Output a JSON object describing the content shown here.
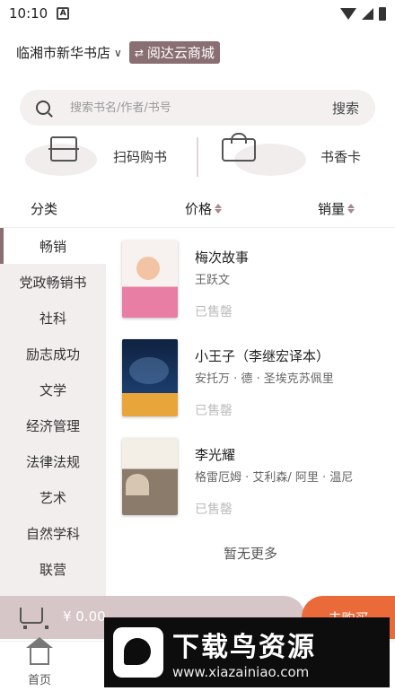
{
  "status_bar": {
    "time": "10:10",
    "notification_icon": "A"
  },
  "header": {
    "store_name": "临湘市新华书店",
    "store_chevron": "∨",
    "platform_name": "阅达云商城",
    "swap_symbol": "⇄"
  },
  "search": {
    "placeholder": "搜索书名/作者/书号",
    "button_label": "搜索"
  },
  "quick_actions": {
    "scan": {
      "label": "扫码购书",
      "icon": "scan-icon"
    },
    "card": {
      "label": "书香卡",
      "icon": "gift-card-icon"
    }
  },
  "filters": {
    "category": "分类",
    "price": "价格",
    "sales": "销量"
  },
  "sidebar": {
    "items": [
      {
        "label": "畅销"
      },
      {
        "label": "党政畅销书"
      },
      {
        "label": "社科"
      },
      {
        "label": "励志成功"
      },
      {
        "label": "文学"
      },
      {
        "label": "经济管理"
      },
      {
        "label": "法律法规"
      },
      {
        "label": "艺术"
      },
      {
        "label": "自然学科"
      },
      {
        "label": "联营"
      }
    ],
    "active_index": 0
  },
  "books": [
    {
      "title": "梅次故事",
      "author": "王跃文",
      "status": "已售罄"
    },
    {
      "title": "小王子（李继宏译本）",
      "author": "安托万 · 德 · 圣埃克苏佩里",
      "status": "已售罄"
    },
    {
      "title": "李光耀",
      "author": "格雷厄姆 · 艾利森/ 阿里 · 温尼",
      "status": "已售罄"
    }
  ],
  "no_more_text": "暂无更多",
  "cart": {
    "total": "¥ 0.00",
    "checkout_label": "去购买"
  },
  "tabs": [
    {
      "label": "首页",
      "icon": "home-icon"
    },
    {
      "label": "",
      "icon": ""
    },
    {
      "label": "",
      "icon": ""
    },
    {
      "label": "",
      "icon": ""
    },
    {
      "label": "",
      "icon": ""
    }
  ],
  "watermark": {
    "title": "下载鸟资源",
    "url": "www.xiazainiao.com"
  }
}
